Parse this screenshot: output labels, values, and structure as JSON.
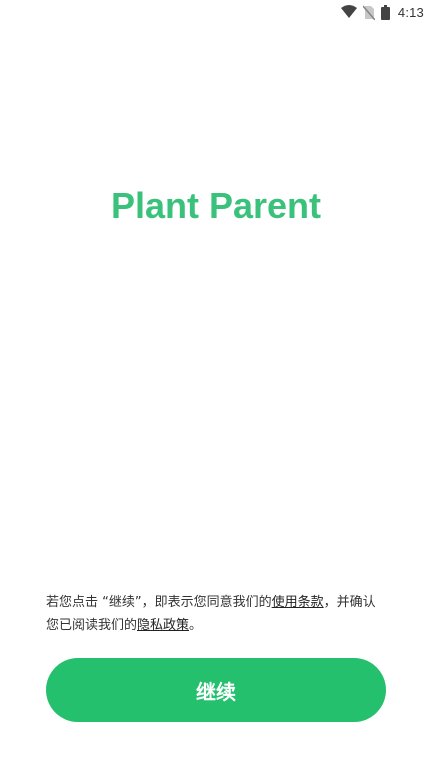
{
  "status_bar": {
    "time": "4:13",
    "icons": [
      "wifi-icon",
      "no-sim-icon",
      "battery-icon"
    ]
  },
  "colors": {
    "brand_green": "#3ac17b",
    "button_green": "#24c06e",
    "text": "#333333"
  },
  "app": {
    "title": "Plant Parent"
  },
  "consent": {
    "prefix": "若您点击 “继续”，即表示您同意我们的",
    "terms_link": "使用条款",
    "middle": "，并确认您已阅读我们的",
    "privacy_link": "隐私政策",
    "suffix": "。"
  },
  "continue_button": {
    "label": "继续"
  }
}
